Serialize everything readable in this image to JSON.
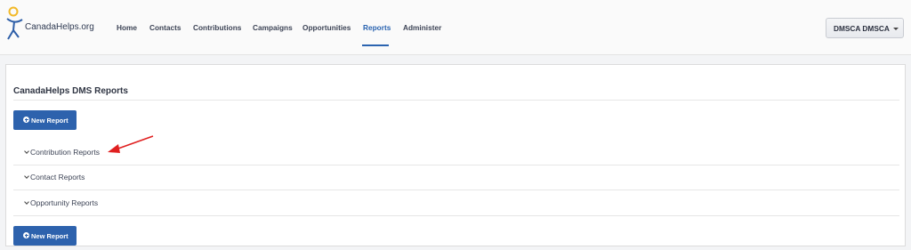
{
  "logo": {
    "text": "CanadaHelps.org"
  },
  "nav": {
    "items": [
      {
        "label": "Home"
      },
      {
        "label": "Contacts"
      },
      {
        "label": "Contributions"
      },
      {
        "label": "Campaigns"
      },
      {
        "label": "Opportunities"
      },
      {
        "label": "Reports",
        "active": true
      },
      {
        "label": "Administer"
      }
    ]
  },
  "user_menu": {
    "label": "DMSCA DMSCA"
  },
  "panel": {
    "title": "CanadaHelps DMS Reports",
    "new_report_label": "New Report",
    "sections": [
      {
        "label": "Contribution Reports"
      },
      {
        "label": "Contact Reports"
      },
      {
        "label": "Opportunity Reports"
      }
    ]
  },
  "colors": {
    "accent": "#2b64b0",
    "button": "#2d62ad",
    "annotation_arrow": "#e02020",
    "logo_yellow": "#f2b928",
    "logo_blue": "#2f5fa8"
  }
}
